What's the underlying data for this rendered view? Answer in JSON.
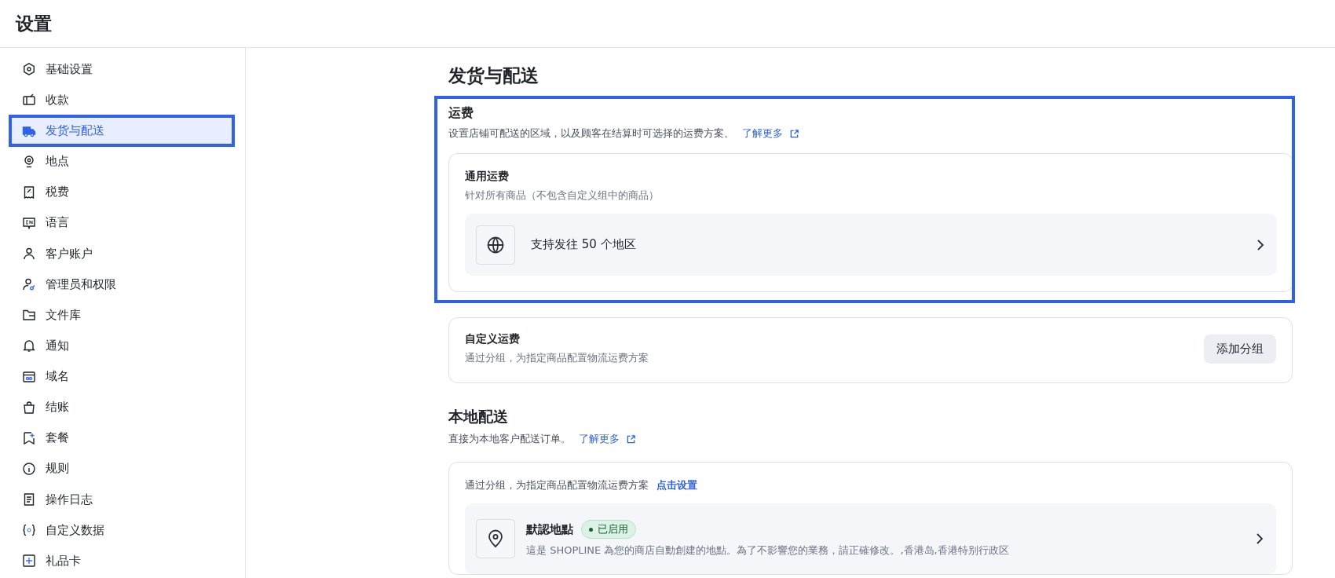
{
  "header": {
    "title": "设置"
  },
  "sidebar": {
    "items": [
      {
        "label": "基础设置",
        "selected": false,
        "highlighted": false
      },
      {
        "label": "收款",
        "selected": false,
        "highlighted": false
      },
      {
        "label": "发货与配送",
        "selected": true,
        "highlighted": true
      },
      {
        "label": "地点",
        "selected": false,
        "highlighted": false
      },
      {
        "label": "税费",
        "selected": false,
        "highlighted": false
      },
      {
        "label": "语言",
        "selected": false,
        "highlighted": false
      },
      {
        "label": "客户账户",
        "selected": false,
        "highlighted": false
      },
      {
        "label": "管理员和权限",
        "selected": false,
        "highlighted": false
      },
      {
        "label": "文件库",
        "selected": false,
        "highlighted": false
      },
      {
        "label": "通知",
        "selected": false,
        "highlighted": false
      },
      {
        "label": "域名",
        "selected": false,
        "highlighted": false
      },
      {
        "label": "结账",
        "selected": false,
        "highlighted": false
      },
      {
        "label": "套餐",
        "selected": false,
        "highlighted": false
      },
      {
        "label": "规则",
        "selected": false,
        "highlighted": false
      },
      {
        "label": "操作日志",
        "selected": false,
        "highlighted": false
      },
      {
        "label": "自定义数据",
        "selected": false,
        "highlighted": false
      },
      {
        "label": "礼品卡",
        "selected": false,
        "highlighted": false
      }
    ]
  },
  "page_title": "发货与配送",
  "shipping_rates": {
    "title": "运费",
    "description": "设置店铺可配送的区域，以及顾客在结算时可选择的运费方案。",
    "link": "了解更多",
    "highlighted": true,
    "general": {
      "title": "通用运费",
      "subtitle": "针对所有商品（不包含自定义组中的商品）",
      "row": "支持发往 50 个地区"
    },
    "custom": {
      "title": "自定义运费",
      "subtitle": "通过分组，为指定商品配置物流运费方案",
      "button": "添加分组"
    }
  },
  "local_delivery": {
    "title": "本地配送",
    "description": "直接为本地客户配送订单。",
    "link": "了解更多",
    "card_text": "通过分组，为指定商品配置物流运费方案",
    "card_link": "点击设置",
    "locations": [
      {
        "name": "默認地點",
        "status": "已启用",
        "enabled": true,
        "description": "這是 SHOPLINE 為您的商店自動創建的地點。為了不影響您的業務，請正確修改。,香港岛,香港特别行政区"
      }
    ]
  }
}
